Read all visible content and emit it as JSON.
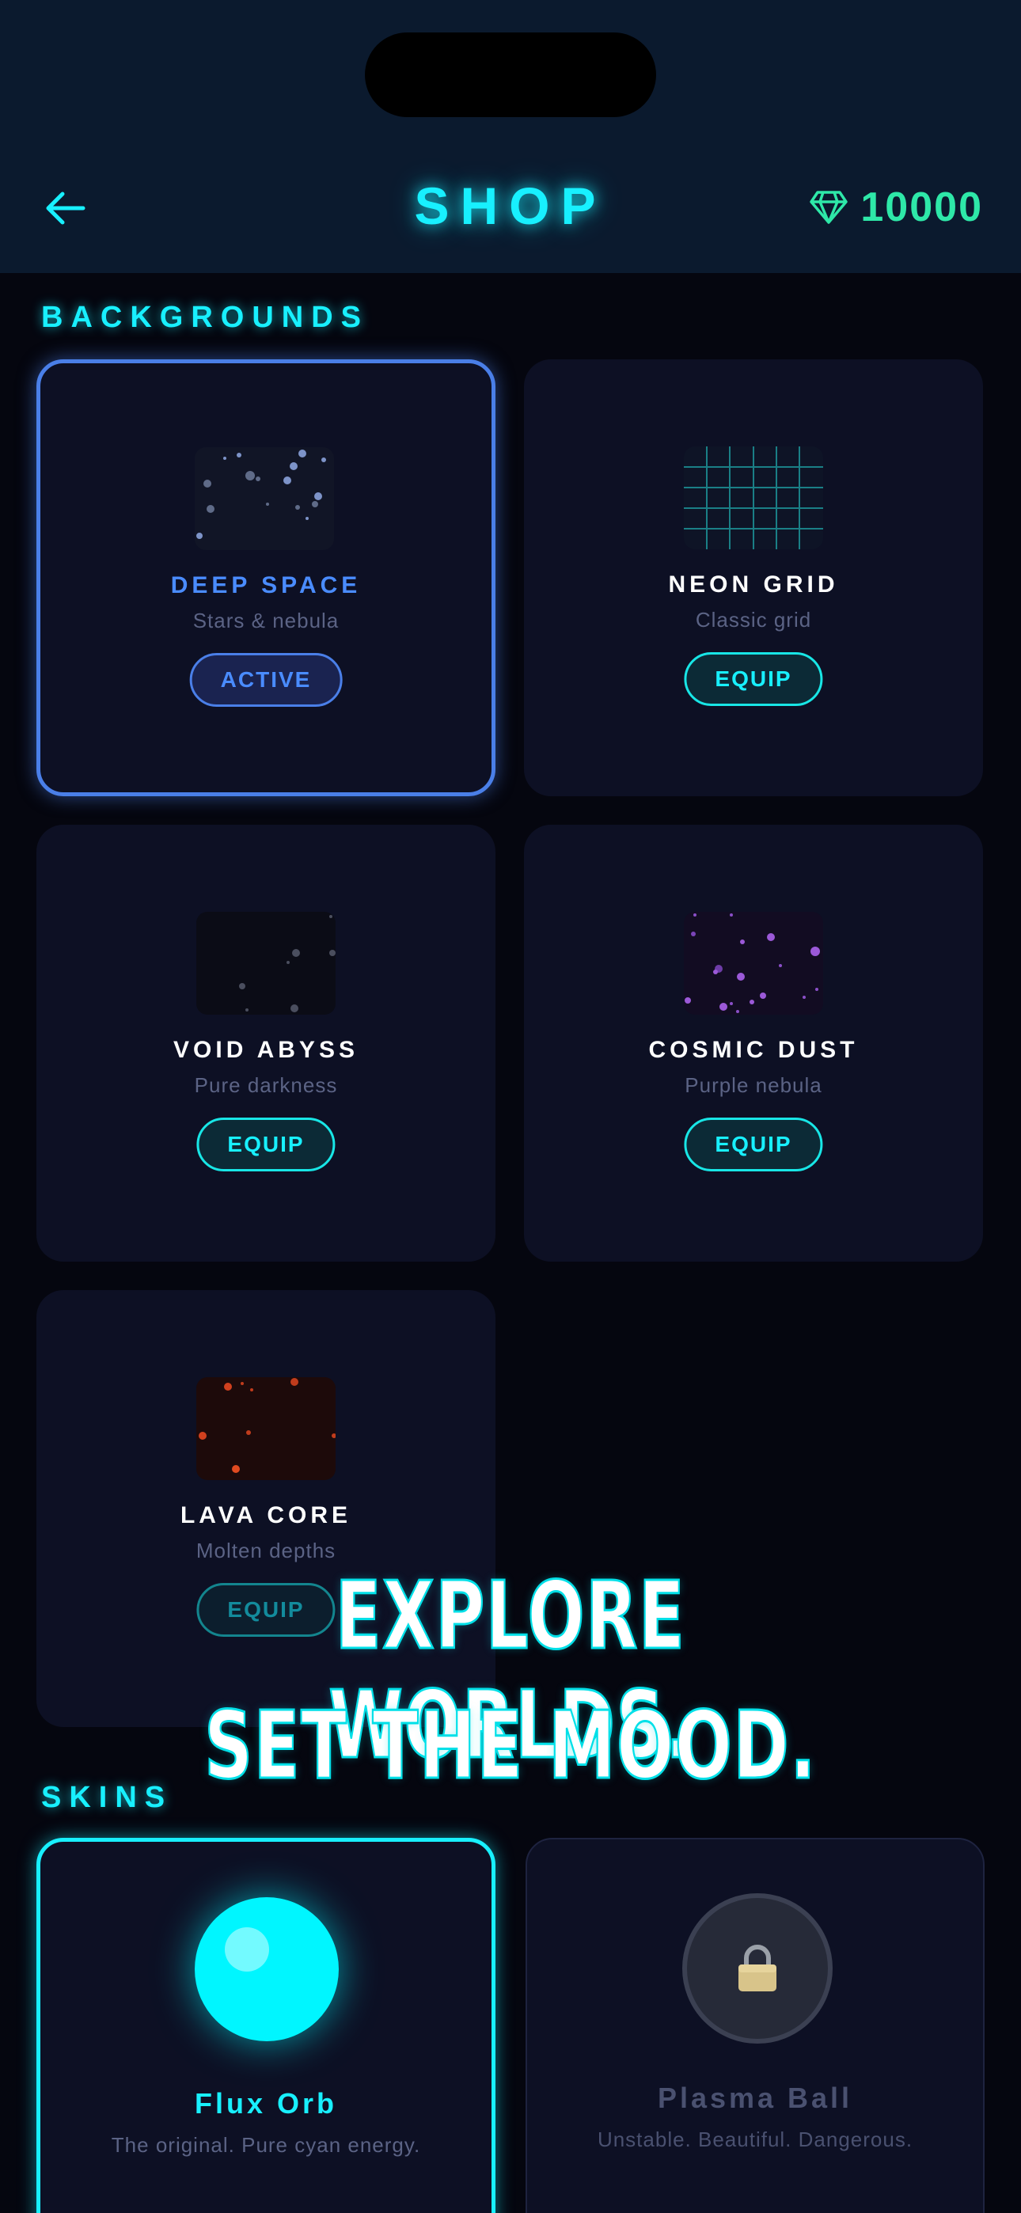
{
  "header": {
    "title": "SHOP",
    "gems": "10000",
    "gem_color": "#2ee8a8",
    "back_icon": "arrow-left-icon",
    "gem_icon": "gem-icon"
  },
  "sections": {
    "backgrounds": "BACKGROUNDS",
    "skins": "SKINS"
  },
  "backgrounds": [
    {
      "name": "DEEP SPACE",
      "sub": "Stars & nebula",
      "action": "ACTIVE"
    },
    {
      "name": "NEON GRID",
      "sub": "Classic grid",
      "action": "EQUIP"
    },
    {
      "name": "VOID ABYSS",
      "sub": "Pure darkness",
      "action": "EQUIP"
    },
    {
      "name": "COSMIC DUST",
      "sub": "Purple nebula",
      "action": "EQUIP"
    },
    {
      "name": "LAVA CORE",
      "sub": "Molten depths",
      "action": "EQUIP"
    }
  ],
  "skins": [
    {
      "name": "Flux Orb",
      "sub": "The original. Pure cyan energy.",
      "color": "#18f0ff"
    },
    {
      "name": "Plasma Ball",
      "sub": "Unstable. Beautiful. Dangerous.",
      "color": "#4a5170",
      "icon": "lock-icon"
    }
  ],
  "overlay": {
    "line1": "EXPLORE WORLDS.",
    "line2": "SET THE MOOD."
  },
  "colors": {
    "accent": "#18f0ff",
    "active": "#4a7fe8",
    "background": "#05060f"
  }
}
